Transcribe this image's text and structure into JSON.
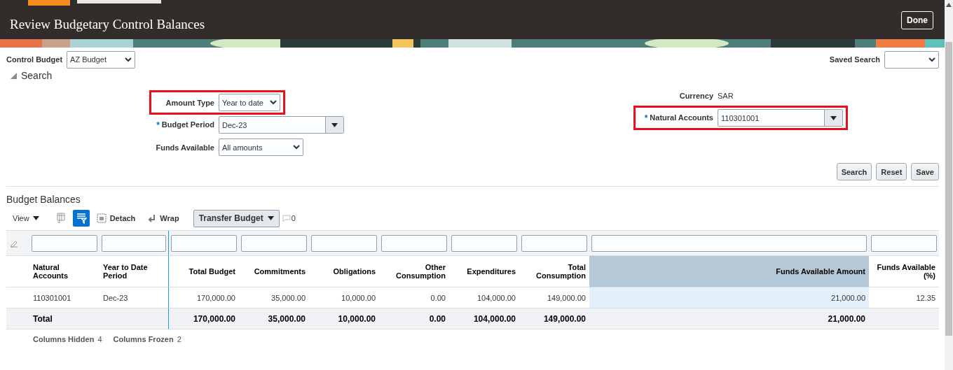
{
  "header": {
    "title": "Review Budgetary Control Balances",
    "done_button": "Done"
  },
  "control_budget": {
    "label": "Control Budget",
    "value": "AZ Budget"
  },
  "saved_search": {
    "label": "Saved Search"
  },
  "search_section": {
    "title": "Search",
    "expanded": true
  },
  "fields_left": [
    {
      "kind": "select",
      "label": "Amount Type",
      "value": "Year to date",
      "highlighted": true
    },
    {
      "kind": "combo",
      "required_mark": "*",
      "label": "Budget Period",
      "value": "Dec-23",
      "highlighted": false
    },
    {
      "kind": "select",
      "label": "Funds Available",
      "value": "All amounts",
      "highlighted": false
    }
  ],
  "fields_right": [
    {
      "kind": "text",
      "label": "Currency",
      "value": "SAR",
      "highlighted": false
    },
    {
      "kind": "combo",
      "required_mark": "*",
      "label": "Natural Accounts",
      "value": "110301001",
      "highlighted": true
    }
  ],
  "search_buttons": [
    "Search",
    "Reset",
    "Save"
  ],
  "budget_balances": {
    "title": "Budget Balances",
    "toolbar": {
      "view": "View",
      "detach": "Detach",
      "wrap": "Wrap",
      "transfer": "Transfer Budget",
      "count": "0"
    },
    "columns": [
      {
        "label": "Natural Accounts",
        "selected": false
      },
      {
        "label": "Year to Date Period",
        "selected": false
      },
      {
        "label": "Total Budget",
        "selected": false
      },
      {
        "label": "Commitments",
        "selected": false
      },
      {
        "label": "Obligations",
        "selected": false
      },
      {
        "label": "Other Consumption",
        "selected": false
      },
      {
        "label": "Expenditures",
        "selected": false
      },
      {
        "label": "Total Consumption",
        "selected": false
      },
      {
        "label": "Funds Available Amount",
        "selected": true
      },
      {
        "label": "Funds Available (%)",
        "selected": false
      }
    ],
    "rows": [
      [
        "110301001",
        "Dec-23",
        "170,000.00",
        "35,000.00",
        "10,000.00",
        "0.00",
        "104,000.00",
        "149,000.00",
        "21,000.00",
        "12.35"
      ]
    ],
    "total_row": {
      "label": "Total",
      "amounts": [
        "170,000.00",
        "35,000.00",
        "10,000.00",
        "0.00",
        "104,000.00",
        "149,000.00",
        "21,000.00"
      ]
    },
    "footer": [
      {
        "label": "Columns Hidden",
        "value": "4"
      },
      {
        "label": "Columns Frozen",
        "value": "2"
      }
    ]
  }
}
